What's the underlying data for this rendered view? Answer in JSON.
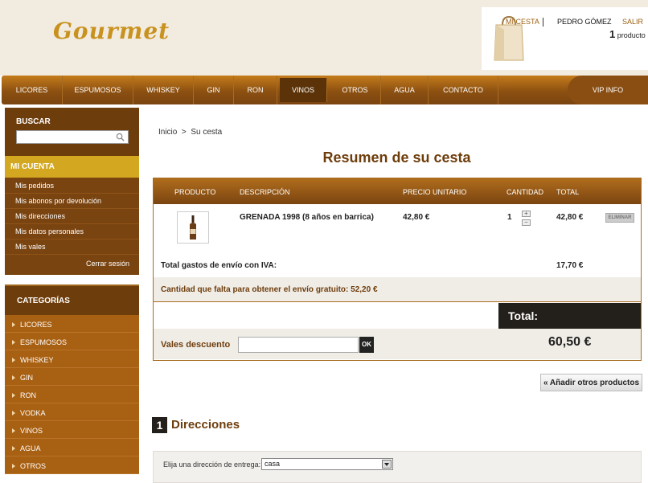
{
  "brand": {
    "logo": "Gourmet"
  },
  "user_bar": {
    "cart_link": "MI CESTA",
    "user": "PEDRO GÓMEZ",
    "logout": "SALIR",
    "count": "1",
    "count_label": "producto"
  },
  "nav": {
    "items": [
      "LICORES",
      "ESPUMOSOS",
      "WHISKEY",
      "GIN",
      "RON",
      "VINOS",
      "OTROS",
      "AGUA",
      "CONTACTO"
    ],
    "active": "VINOS",
    "vip": "VIP INFO"
  },
  "sidebar": {
    "search_label": "BUSCAR",
    "search_value": "",
    "account_title": "MI CUENTA",
    "account_items": [
      "Mis pedidos",
      "Mis abonos por devolución",
      "Mis direcciones",
      "Mis datos personales",
      "Mis vales"
    ],
    "logout": "Cerrar sesión",
    "categories_title": "CATEGORÍAS",
    "categories": [
      "LICORES",
      "ESPUMOSOS",
      "WHISKEY",
      "GIN",
      "RON",
      "VODKA",
      "VINOS",
      "AGUA",
      "OTROS"
    ]
  },
  "breadcrumb": {
    "home": "Inicio",
    "sep": ">",
    "current": "Su cesta"
  },
  "page_title": "Resumen de su cesta",
  "cart": {
    "headers": {
      "product": "PRODUCTO",
      "description": "DESCRIPCIÓN",
      "unit_price": "PRECIO UNITARIO",
      "quantity": "CANTIDAD",
      "total": "TOTAL"
    },
    "item": {
      "description": "GRENADA 1998 (8 años en barrica)",
      "unit_price": "42,80 €",
      "quantity": "1",
      "total": "42,80 €",
      "remove": "ELIMINAR"
    },
    "shipping_label": "Total gastos de envío con IVA:",
    "shipping_value": "17,70 €",
    "free_shipping_note": "Cantidad que falta para obtener el envío gratuito: 52,20 €",
    "total_label": "Total:",
    "voucher_label": "Vales descuento",
    "voucher_value": "",
    "voucher_ok": "OK",
    "total_value": "60,50 €"
  },
  "continue_button": "« Añadir otros productos",
  "addresses": {
    "step": "1",
    "title": "Direcciones",
    "select_label": "Elija una dirección de entrega:",
    "selected": "casa"
  },
  "colors": {
    "brown": "#6e3d0c",
    "gold": "#d3a71f",
    "orange": "#a86012"
  }
}
